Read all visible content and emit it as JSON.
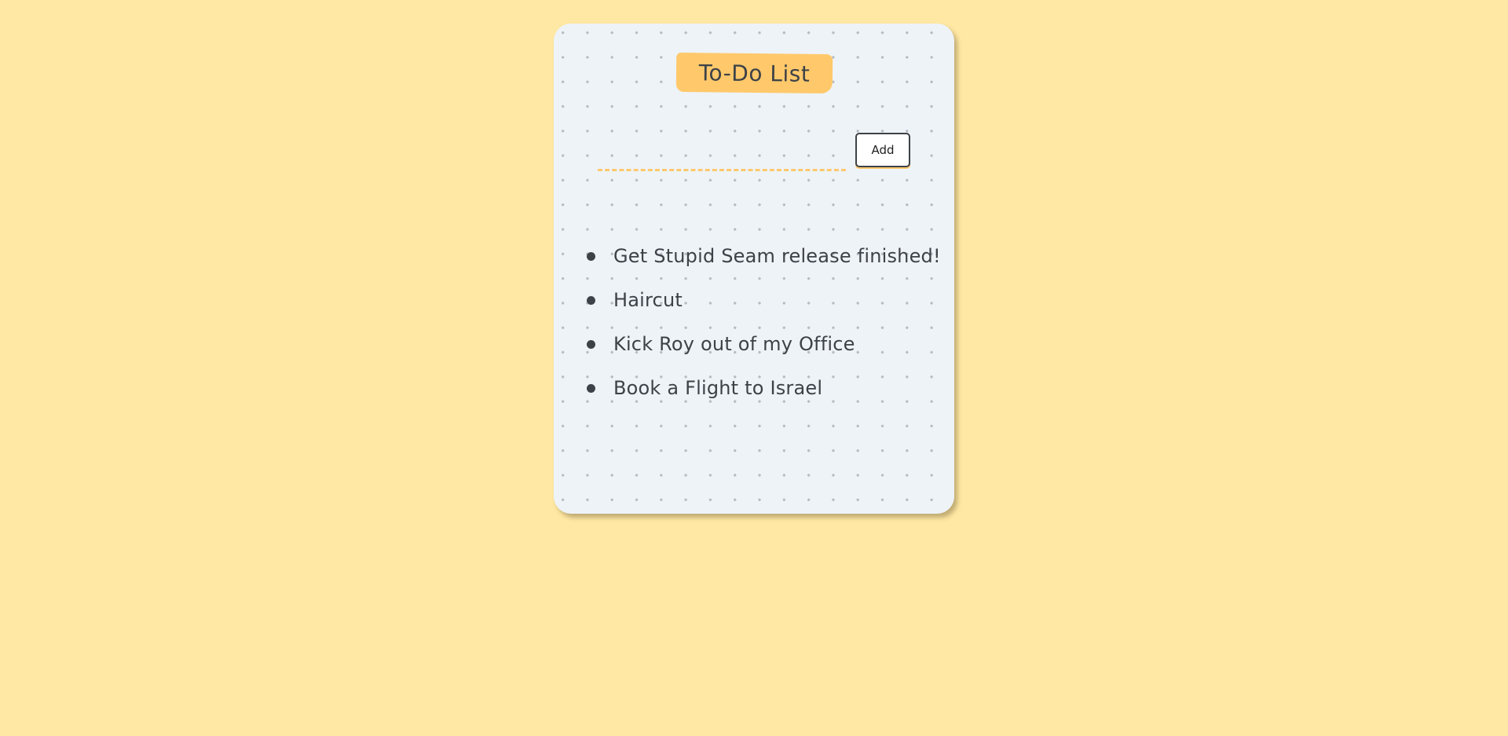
{
  "card": {
    "title": "To-Do List"
  },
  "form": {
    "input_value": "",
    "input_placeholder": "",
    "add_label": "Add"
  },
  "todos": [
    {
      "label": "Get Stupid Seam release finished!"
    },
    {
      "label": "Haircut"
    },
    {
      "label": "Kick Roy out of my Office"
    },
    {
      "label": "Book a Flight to Israel"
    }
  ],
  "colors": {
    "page_background": "#ffe8a3",
    "card_background": "#eef3f8",
    "accent": "#ffc96b",
    "text": "#3d4248"
  }
}
